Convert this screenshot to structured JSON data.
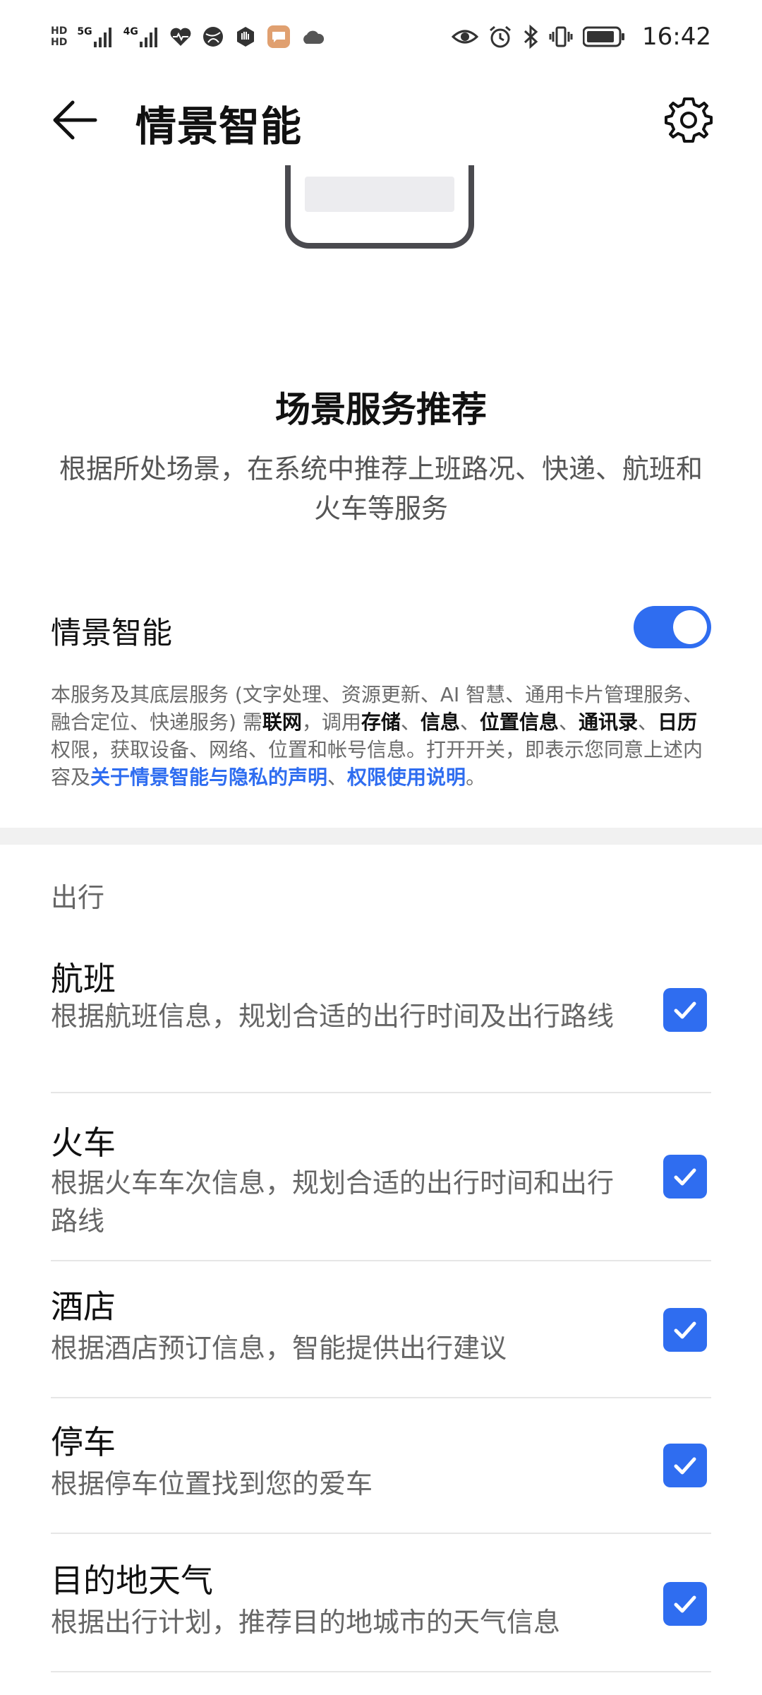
{
  "status_bar": {
    "left_icons": [
      "hd-icon",
      "5g-signal-icon",
      "4g-signal-icon",
      "heart-rate-icon",
      "browser-icon",
      "hand-icon",
      "message-icon",
      "cloud-icon"
    ],
    "right_icons": [
      "eye-icon",
      "alarm-icon",
      "bluetooth-icon",
      "vibrate-icon",
      "battery-icon"
    ],
    "network_5g": "5G",
    "network_4g": "4G",
    "time": "16:42"
  },
  "header": {
    "title": "情景智能"
  },
  "intro": {
    "title": "场景服务推荐",
    "description": "根据所处场景，在系统中推荐上班路况、快递、航班和火车等服务"
  },
  "main_toggle": {
    "label": "情景智能",
    "enabled": true
  },
  "notice": {
    "p1": "本服务及其底层服务 (文字处理、资源更新、AI 智慧、通用卡片管理服务、融合定位、快递服务) 需",
    "b1": "联网",
    "p2": "，调用",
    "b2": "存储",
    "p3": "、",
    "b3": "信息",
    "p4": "、",
    "b4": "位置信息",
    "p5": "、",
    "b5": "通讯录",
    "p6": "、",
    "b6": "日历",
    "p7": "权限，获取设备、网络、位置和帐号信息。打开开关，即表示您同意上述内容及",
    "link1": "关于情景智能与隐私的声明",
    "p8": "、",
    "link2": "权限使用说明",
    "p9": "。"
  },
  "section": {
    "label": "出行"
  },
  "items": [
    {
      "title": "航班",
      "desc": "根据航班信息，规划合适的出行时间及出行路线",
      "checked": true
    },
    {
      "title": "火车",
      "desc": "根据火车车次信息，规划合适的出行时间和出行路线",
      "checked": true
    },
    {
      "title": "酒店",
      "desc": "根据酒店预订信息，智能提供出行建议",
      "checked": true
    },
    {
      "title": "停车",
      "desc": "根据停车位置找到您的爱车",
      "checked": true
    },
    {
      "title": "目的地天气",
      "desc": "根据出行计划，推荐目的地城市的天气信息",
      "checked": true
    }
  ],
  "colors": {
    "accent": "#2f6df0",
    "divider": "#e6e6e6",
    "section_bg": "#f1f1f1"
  }
}
